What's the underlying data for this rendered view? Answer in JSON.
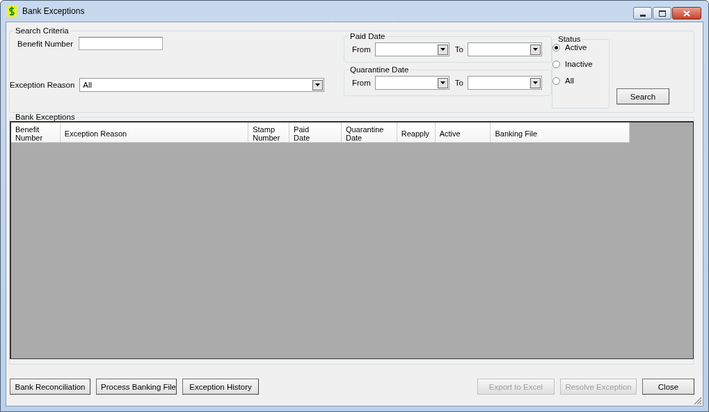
{
  "window": {
    "title": "Bank Exceptions"
  },
  "search_criteria": {
    "title": "Search Criteria",
    "benefit_number": {
      "label": "Benefit Number"
    },
    "exception_reason": {
      "label": "Exception Reason",
      "value": "All"
    },
    "paid_date": {
      "title": "Paid Date",
      "from_label": "From",
      "to_label": "To"
    },
    "quarantine_date": {
      "title": "Quarantine Date",
      "from_label": "From",
      "to_label": "To"
    },
    "status": {
      "title": "Status",
      "options": [
        {
          "label": "Active",
          "selected": true
        },
        {
          "label": "Inactive",
          "selected": false
        },
        {
          "label": "All",
          "selected": false
        }
      ]
    },
    "search_button": "Search"
  },
  "bank_exceptions": {
    "title": "Bank Exceptions",
    "columns": [
      "Benefit\nNumber",
      "Exception Reason",
      "Stamp\nNumber",
      "Paid\nDate",
      "Quarantine\nDate",
      "Reapply",
      "Active",
      "Banking File"
    ]
  },
  "left_buttons": [
    {
      "label": "Bank Reconciliation",
      "disabled": false
    },
    {
      "label": "Process Banking File",
      "disabled": false
    },
    {
      "label": "Exception History",
      "disabled": false
    }
  ],
  "right_buttons": [
    {
      "label": "Export to Excel",
      "disabled": true
    },
    {
      "label": "Resolve Exception",
      "disabled": true
    },
    {
      "label": "Close",
      "disabled": false
    }
  ]
}
